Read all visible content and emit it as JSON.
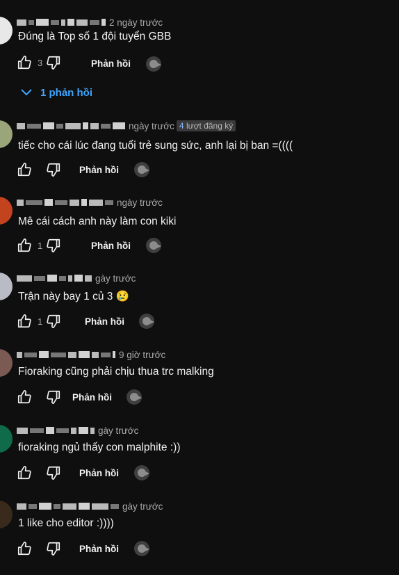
{
  "comments": [
    {
      "time": "2 ngày trước",
      "subs_count": "",
      "subs_text": "",
      "text": "Đúng là Top số 1 đội tuyển GBB",
      "likes": "3",
      "reply": "Phản hồi",
      "avatar_color": "#e8e8e8"
    },
    {
      "time": "ngày trước",
      "subs_count": "4",
      "subs_text": "lượt đăng ký",
      "text": "tiếc cho cái lúc đang tuổi trẻ sung sức, anh lại bị ban =((((",
      "likes": "",
      "reply": "Phản hồi",
      "avatar_color": "#9aa57a"
    },
    {
      "time": "ngày trước",
      "subs_count": "",
      "subs_text": "",
      "text": "Mê cái cách anh này làm con kiki",
      "likes": "1",
      "reply": "Phản hồi",
      "avatar_color": "#c4431f"
    },
    {
      "time": "gày trước",
      "subs_count": "",
      "subs_text": "",
      "text": "Trận này bay 1 củ 3 😢",
      "likes": "1",
      "reply": "Phản hồi",
      "avatar_color": "#b9bcc4"
    },
    {
      "time": "9 giờ trước",
      "subs_count": "",
      "subs_text": "",
      "text": "Fioraking cũng phải chịu thua trc malking",
      "likes": "",
      "reply": "Phản hồi",
      "avatar_color": "#7a5a52"
    },
    {
      "time": "gày trước",
      "subs_count": "",
      "subs_text": "",
      "text": "fioraking ngủ thấy con malphite :))",
      "likes": "",
      "reply": "Phản hồi",
      "avatar_color": "#0f6b4a"
    },
    {
      "time": "gày trước",
      "subs_count": "",
      "subs_text": "",
      "text": "1 like cho editor :))))",
      "likes": "",
      "reply": "Phản hồi",
      "avatar_color": "#3a2a1c"
    }
  ],
  "replies_toggle": "1 phản hồi",
  "colors": {
    "background": "#0f0f0f",
    "link": "#3ea6ff",
    "meta": "#aaaaaa"
  }
}
